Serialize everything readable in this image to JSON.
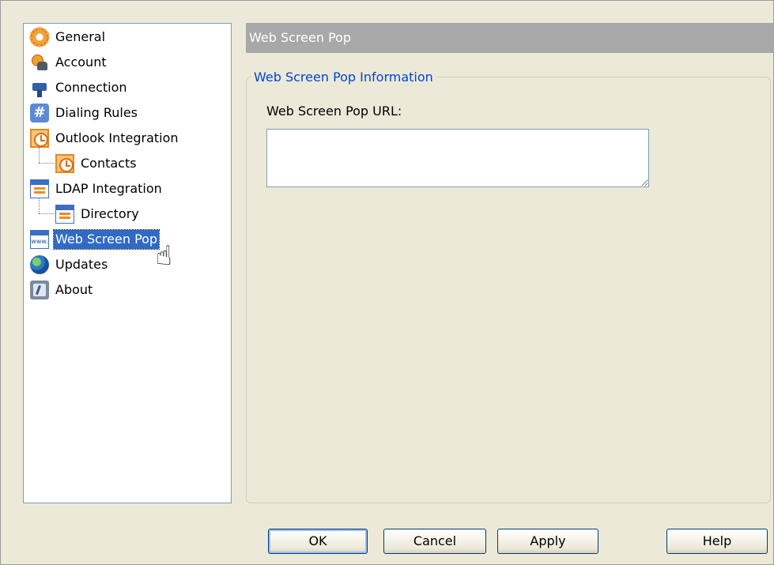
{
  "tree": {
    "items": [
      {
        "label": "General",
        "icon": "gear-icon"
      },
      {
        "label": "Account",
        "icon": "account-icon"
      },
      {
        "label": "Connection",
        "icon": "plug-icon"
      },
      {
        "label": "Dialing Rules",
        "icon": "hash-icon"
      },
      {
        "label": "Outlook Integration",
        "icon": "clock-icon"
      },
      {
        "label": "Contacts",
        "icon": "clock-icon",
        "parent": "Outlook Integration"
      },
      {
        "label": "LDAP Integration",
        "icon": "directory-icon"
      },
      {
        "label": "Directory",
        "icon": "directory-icon",
        "parent": "LDAP Integration"
      },
      {
        "label": "Web Screen Pop",
        "icon": "web-icon",
        "selected": true
      },
      {
        "label": "Updates",
        "icon": "globe-icon"
      },
      {
        "label": "About",
        "icon": "about-icon"
      }
    ],
    "selection_color": "#316ac5"
  },
  "panel": {
    "header": "Web Screen Pop",
    "group_title": "Web Screen Pop Information",
    "url_label": "Web Screen Pop URL:",
    "url_value": ""
  },
  "buttons": {
    "ok": "OK",
    "cancel": "Cancel",
    "apply": "Apply",
    "help": "Help"
  }
}
